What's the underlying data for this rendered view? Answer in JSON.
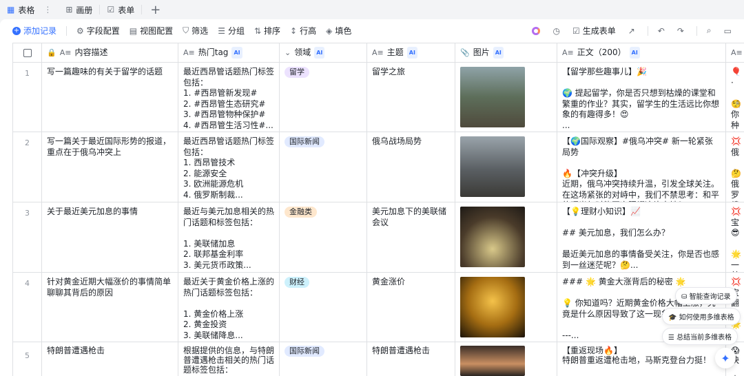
{
  "tabs": [
    {
      "label": "表格",
      "icon": "grid-table-icon"
    },
    {
      "label": "画册",
      "icon": "gallery-icon"
    },
    {
      "label": "表单",
      "icon": "form-icon"
    }
  ],
  "toolbar": {
    "add": "添加记录",
    "fields": "字段配置",
    "view": "视图配置",
    "filter": "筛选",
    "group": "分组",
    "sort": "排序",
    "row_height": "行高",
    "fill": "填色",
    "gen_form": "生成表单"
  },
  "columns": {
    "desc": "内容描述",
    "tag": "热门tag",
    "domain": "领域",
    "topic": "主题",
    "image": "图片",
    "body": "正文（200）",
    "ai": "AI"
  },
  "rows": [
    {
      "n": "1",
      "desc": "写一篇趣味的有关于留学的话题",
      "tag": "最近西昂管话题热门标签包括：\n1. #西昂管新发现#\n2. #西昂管生态研究#\n3. #西昂管物种保护#\n4. #西昂管生活习性#...",
      "domain": "留学",
      "domain_color": "#ece2fe",
      "topic": "留学之旅",
      "body": "【留学那些趣事儿】🎉\n\n🌍 提起留学，你是否只想到枯燥的课堂和繁重的作业？其实，留学生的生活远比你想象的有趣得多！😍\n...",
      "extra": "🎈 ·\n\n🧐你\n种有\n\n😜试"
    },
    {
      "n": "2",
      "desc": "写一篇关于最近国际形势的报道，重点在于俄乌冲突上",
      "tag": "最近西昂管话题热门标签包括：\n1. 西昂管技术\n2. 能源安全\n3. 欧洲能源危机\n4. 俄罗斯制裁...",
      "domain": "国际新闻",
      "domain_color": "#e1eaff",
      "topic": "俄乌战场局势",
      "body": "【🌍国际观察】#俄乌冲突# 新一轮紧张局势\n\n🔥【冲突升级】\n近期，俄乌冲突持续升温，引发全球关注。在这场紧张的对峙中，我们不禁思考：和平的曙光何时能再次照耀这片土地？...",
      "extra": "💢俄\n\n🤔\n俄罗\n俄纵\n称俄"
    },
    {
      "n": "3",
      "desc": "关于最近美元加息的事情",
      "tag": "最近与美元加息相关的热门话题和标签包括：\n\n1. 美联储加息\n2. 联邦基金利率\n3. 美元货币政策...",
      "domain": "金融类",
      "domain_color": "#fee7cd",
      "topic": "美元加息下的美联储会议",
      "body": "【💡理财小知识】📈\n\n## 美元加息，我们怎么办？\n\n最近美元加息的事情备受关注，你是否也感到一丝迷茫呢？🤔...",
      "extra": "💢宝\n😎\n\n🌟一\n美联\n意味"
    },
    {
      "n": "4",
      "desc": "针对黄金近期大幅涨价的事情简单聊聊其背后的原因",
      "tag": "最近关于黄金价格上涨的热门话题标签包括：\n\n1. 黄金价格上涨\n2. 黄金投资\n3. 美联储降息...",
      "domain": "财经",
      "domain_color": "#cdf1fc",
      "topic": "黄金涨价",
      "body": "### 🌟 黄金大涨背后的秘密 🌟\n\n💡 你知道吗？近期黄金价格大幅上涨，究竟是什么原因导致了这一现象呢？\n\n---...",
      "extra": "💢宝\n翻\n\n🌟*\n市场\n题实"
    },
    {
      "n": "5",
      "desc": "特朗普遭遇枪击",
      "tag": "根据提供的信息，与特朗普遭遇枪击相关的热门话题标签包括：",
      "domain": "国际新闻",
      "domain_color": "#e1eaff",
      "topic": "特朗普遭遇枪击",
      "body": "【重返现场🔥】\n特朗普重返遭枪击地，马斯克登台力挺！",
      "extra": "😱快\n\n大家"
    }
  ],
  "assistant": {
    "history": "智能查询记录",
    "howto": "如何使用多维表格",
    "summary": "总结当前多维表格"
  }
}
